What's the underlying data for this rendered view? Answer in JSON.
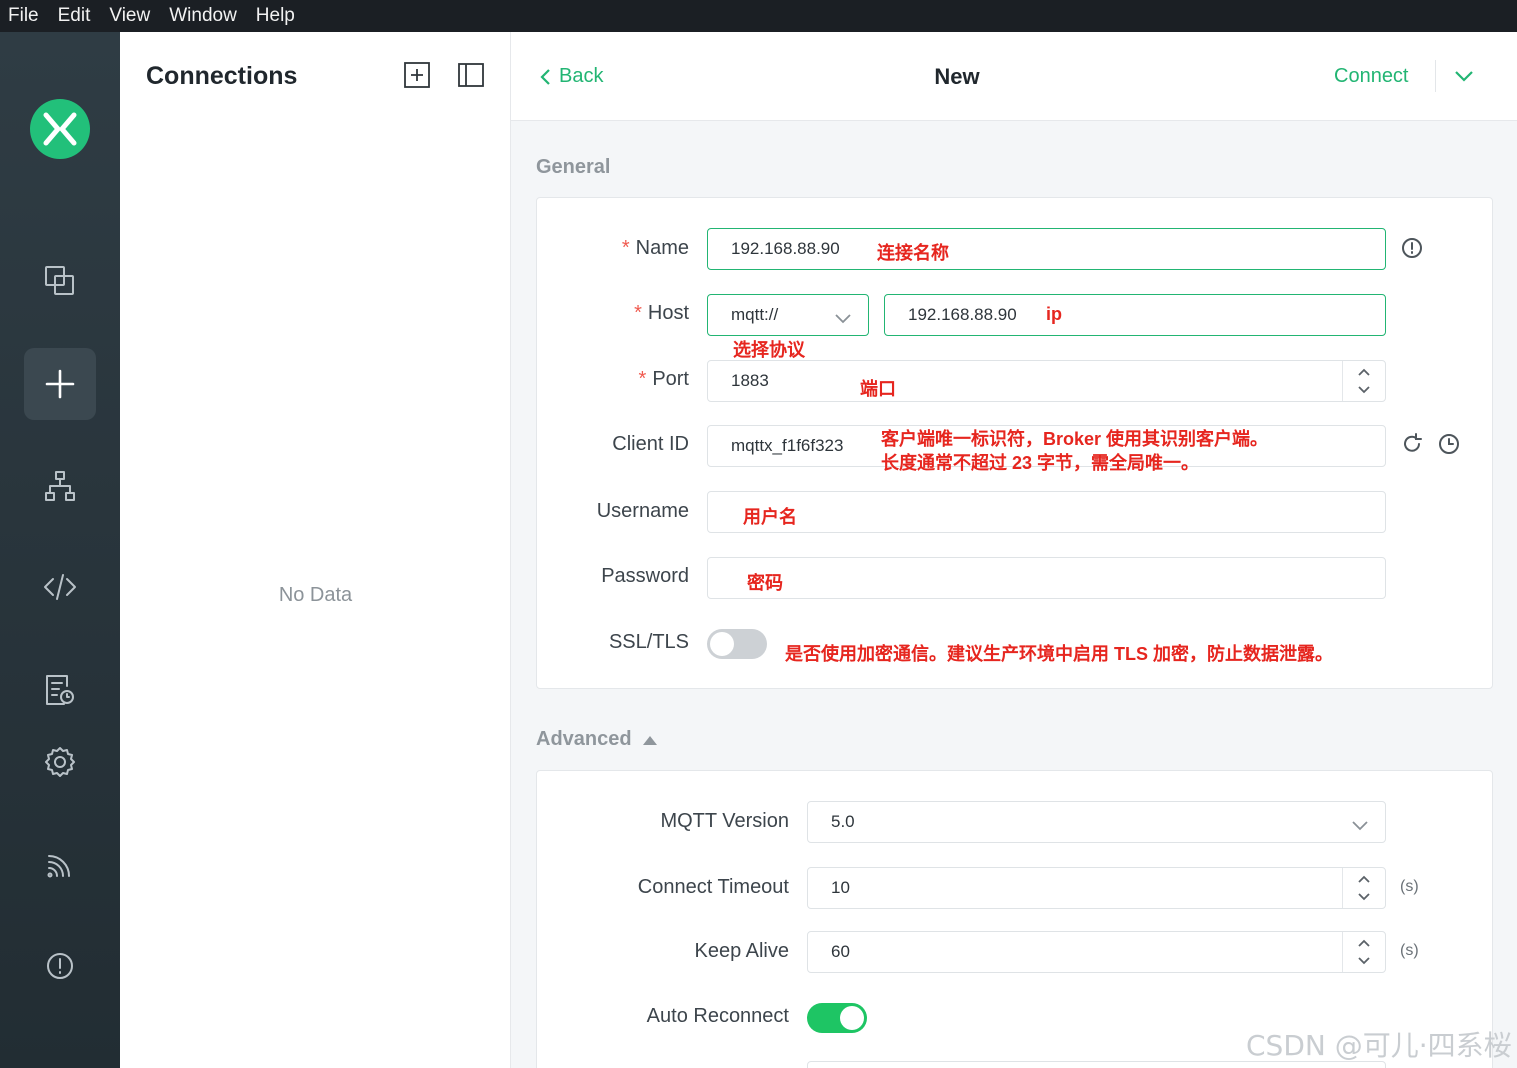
{
  "menubar": {
    "items": [
      "File",
      "Edit",
      "View",
      "Window",
      "Help"
    ]
  },
  "sidebar": {
    "icons": [
      "copy-icon",
      "plus-icon",
      "sitemap-icon",
      "code-icon",
      "log-icon",
      "gear-icon",
      "feed-icon",
      "info-icon"
    ],
    "active": "plus-icon"
  },
  "connections": {
    "title": "Connections",
    "empty_text": "No Data"
  },
  "header": {
    "back_label": "Back",
    "title": "New",
    "connect_label": "Connect"
  },
  "general": {
    "section_label": "General",
    "name": {
      "label": "Name",
      "value": "192.168.88.90",
      "note": "连接名称"
    },
    "host": {
      "label": "Host",
      "protocol": "mqtt://",
      "value": "192.168.88.90",
      "note": "ip",
      "protocol_note": "选择协议"
    },
    "port": {
      "label": "Port",
      "value": "1883",
      "note": "端口"
    },
    "client_id": {
      "label": "Client ID",
      "value": "mqttx_f1f6f323",
      "note_line1": "客户端唯一标识符，Broker 使用其识别客户端。",
      "note_line2": "长度通常不超过 23 字节，需全局唯一。"
    },
    "username": {
      "label": "Username",
      "value": "",
      "note": "用户名"
    },
    "password": {
      "label": "Password",
      "value": "",
      "note": "密码"
    },
    "ssl": {
      "label": "SSL/TLS",
      "enabled": false,
      "note": "是否使用加密通信。建议生产环境中启用 TLS 加密，防止数据泄露。"
    }
  },
  "advanced": {
    "section_label": "Advanced",
    "mqtt_version": {
      "label": "MQTT Version",
      "value": "5.0"
    },
    "connect_timeout": {
      "label": "Connect Timeout",
      "value": "10",
      "unit": "(s)"
    },
    "keep_alive": {
      "label": "Keep Alive",
      "value": "60",
      "unit": "(s)"
    },
    "auto_reconnect": {
      "label": "Auto Reconnect",
      "enabled": true
    }
  },
  "watermark": "CSDN @可儿·四系桜",
  "colors": {
    "accent": "#22b573",
    "annotation": "#e6261f",
    "sidebar": "#2a363d"
  }
}
